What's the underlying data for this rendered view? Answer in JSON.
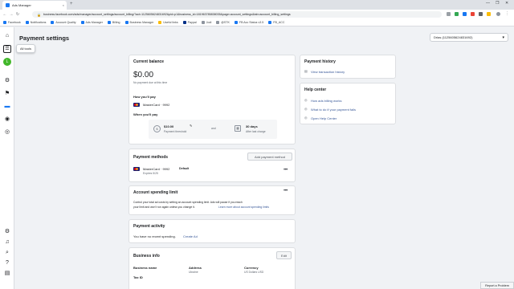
{
  "browser": {
    "tab_title": "Ads Manager",
    "tab_close": "×",
    "new_tab": "+",
    "url": "business.facebook.com/ads/manager/account_settings/account_billing/?act=1125605624831692&pid=p1&business_id=181963785838035&page=account_settings&tab=account_billing_settings",
    "controls": [
      "—",
      "❐",
      "✕"
    ],
    "nav": [
      "←",
      "→",
      "↻"
    ],
    "bookmarks": [
      "Facebook",
      "Notifications",
      "Account Quality",
      "Ads Manager",
      "Billing",
      "Business Manager",
      "Useful links",
      "Paypal",
      "Jodi",
      "@STK",
      "FB Acc Status v3.5",
      "FB_ACC"
    ],
    "accent": "#1877f2"
  },
  "rail": {
    "tooltip": "All tools",
    "avatar_letter": "L",
    "icons": [
      "home-icon",
      "menu-icon",
      "account-icon",
      "campaigns-icon",
      "flag-icon",
      "billing-icon",
      "globe-icon",
      "events-icon",
      "settings-icon",
      "notifications-icon",
      "search-icon",
      "help-icon",
      "library-icon"
    ]
  },
  "header": {
    "title": "Payment settings",
    "account_selector": "Drlas (1125605624831692)"
  },
  "current_balance": {
    "title": "Current balance",
    "amount": "$0.00",
    "note": "No payment due at this time",
    "how_pay_label": "How you'll pay",
    "card": "MasterCard · 9992",
    "when_pay_label": "When you'll pay",
    "threshold_value": "$10.00",
    "threshold_label": "Payment threshold",
    "and": "and",
    "days_value": "30 days",
    "days_label": "After last charge"
  },
  "payment_methods": {
    "title": "Payment methods",
    "add_button": "Add payment method",
    "card": "MasterCard · 9992",
    "default_badge": "Default",
    "expires": "Expires 5/25",
    "more": "•••"
  },
  "spending_limit": {
    "title": "Account spending limit",
    "more": "•••",
    "text_1": "Control your total ad costs by setting an account spending limit. Ads will pause if you reach",
    "text_2": "your limit and won't run again unless you change it.",
    "link": "Learn more about account spending limits"
  },
  "payment_activity": {
    "title": "Payment activity",
    "text": "You have no recent spending.",
    "link": "Create Ad"
  },
  "business_info": {
    "title": "Business info",
    "edit": "Edit",
    "col1_label": "Business name",
    "col2_label": "Address",
    "col2_value": "Ukraine",
    "col3_label": "Currency",
    "col3_value": "US Dollars USD",
    "tax_label": "Tax ID"
  },
  "payment_history": {
    "title": "Payment history",
    "link": "View transaction history"
  },
  "help_center": {
    "title": "Help center",
    "links": [
      "How ads billing works",
      "What to do if your payment fails",
      "Open Help Center"
    ]
  },
  "report": "Report a Problem"
}
